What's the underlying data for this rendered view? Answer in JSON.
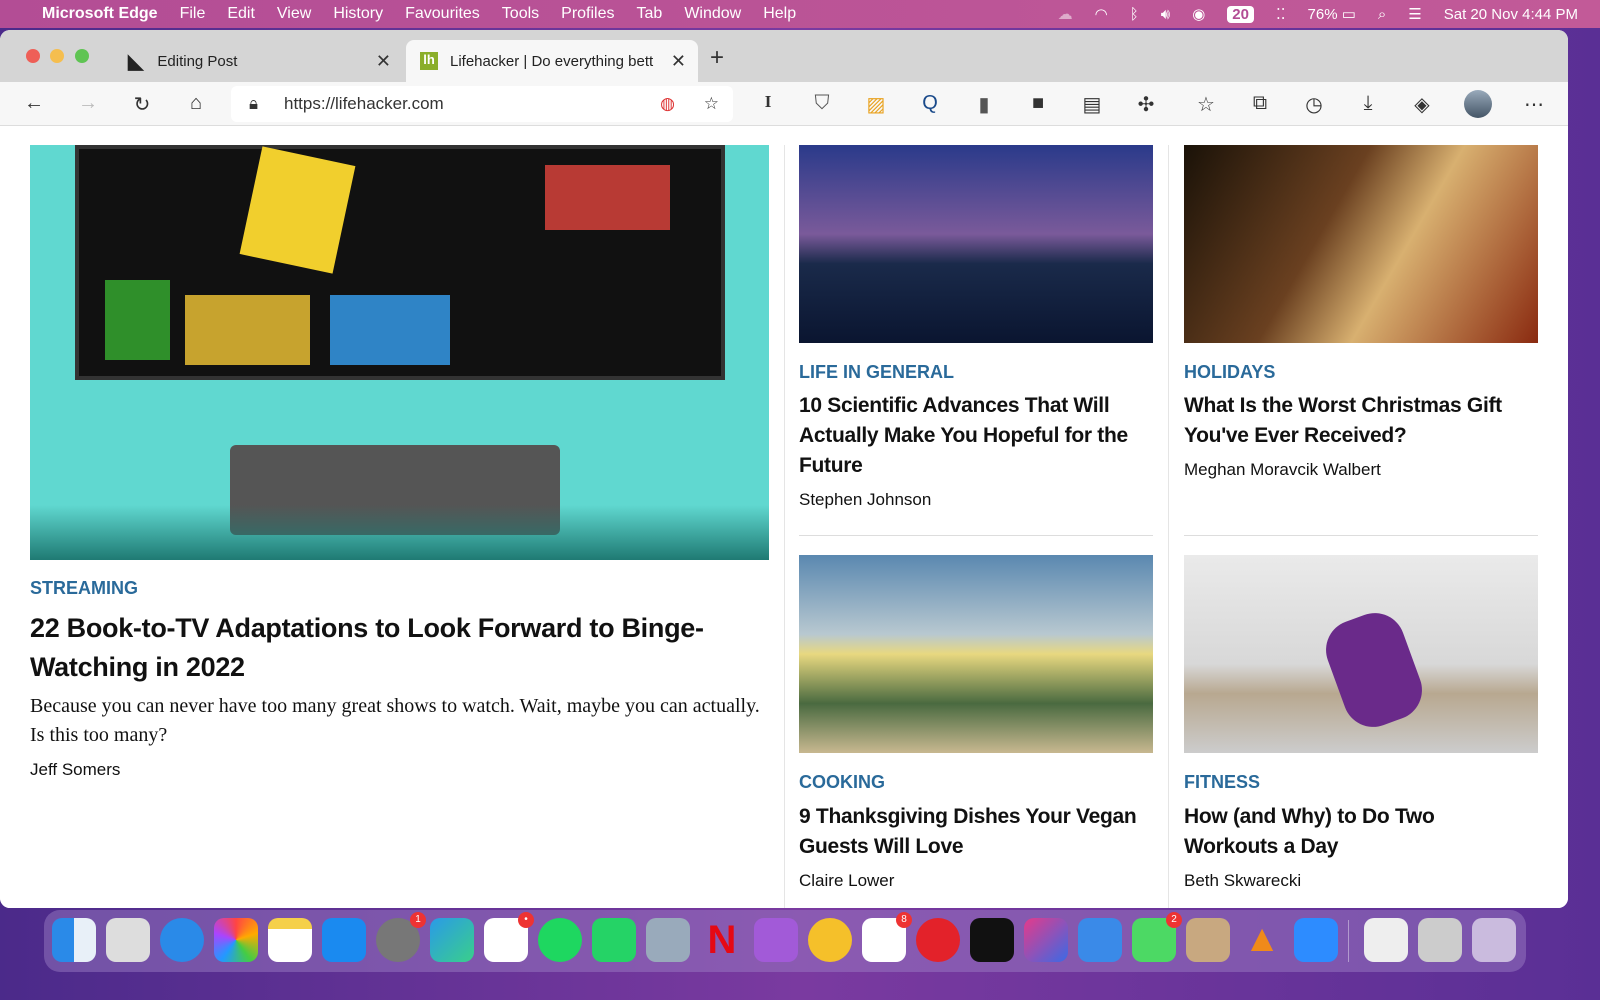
{
  "menubar": {
    "app": "Microsoft Edge",
    "items": [
      "File",
      "Edit",
      "View",
      "History",
      "Favourites",
      "Tools",
      "Profiles",
      "Tab",
      "Window",
      "Help"
    ],
    "calendar_badge": "20",
    "battery": "76%",
    "clock": "Sat 20 Nov  4:44 PM"
  },
  "tabs": [
    {
      "title": "Editing Post"
    },
    {
      "title": "Lifehacker | Do everything bett",
      "active": true
    }
  ],
  "address": {
    "url": "https://lifehacker.com"
  },
  "articles": {
    "featured": {
      "category": "STREAMING",
      "title": "22 Book-to-TV Adaptations to Look Forward to Binge-Watching in 2022",
      "dek": "Because you can never have too many great shows to watch. Wait, maybe you can actually. Is this too many?",
      "author": "Jeff Somers"
    },
    "a1": {
      "category": "LIFE IN GENERAL",
      "title": "10 Scientific Advances That Will Actually Make You Hopeful for the Future",
      "author": "Stephen Johnson"
    },
    "a2": {
      "category": "HOLIDAYS",
      "title": "What Is the Worst Christmas Gift You've Ever Received?",
      "author": "Meghan Moravcik Walbert"
    },
    "a3": {
      "category": "COOKING",
      "title": "9 Thanksgiving Dishes Your Vegan Guests Will Love",
      "author": "Claire Lower"
    },
    "a4": {
      "category": "FITNESS",
      "title": "How (and Why) to Do Two Workouts a Day",
      "author": "Beth Skwarecki"
    }
  },
  "dock": {
    "badges": {
      "settings": "1",
      "slack": "•",
      "reminders": "8",
      "messages": "2"
    }
  }
}
